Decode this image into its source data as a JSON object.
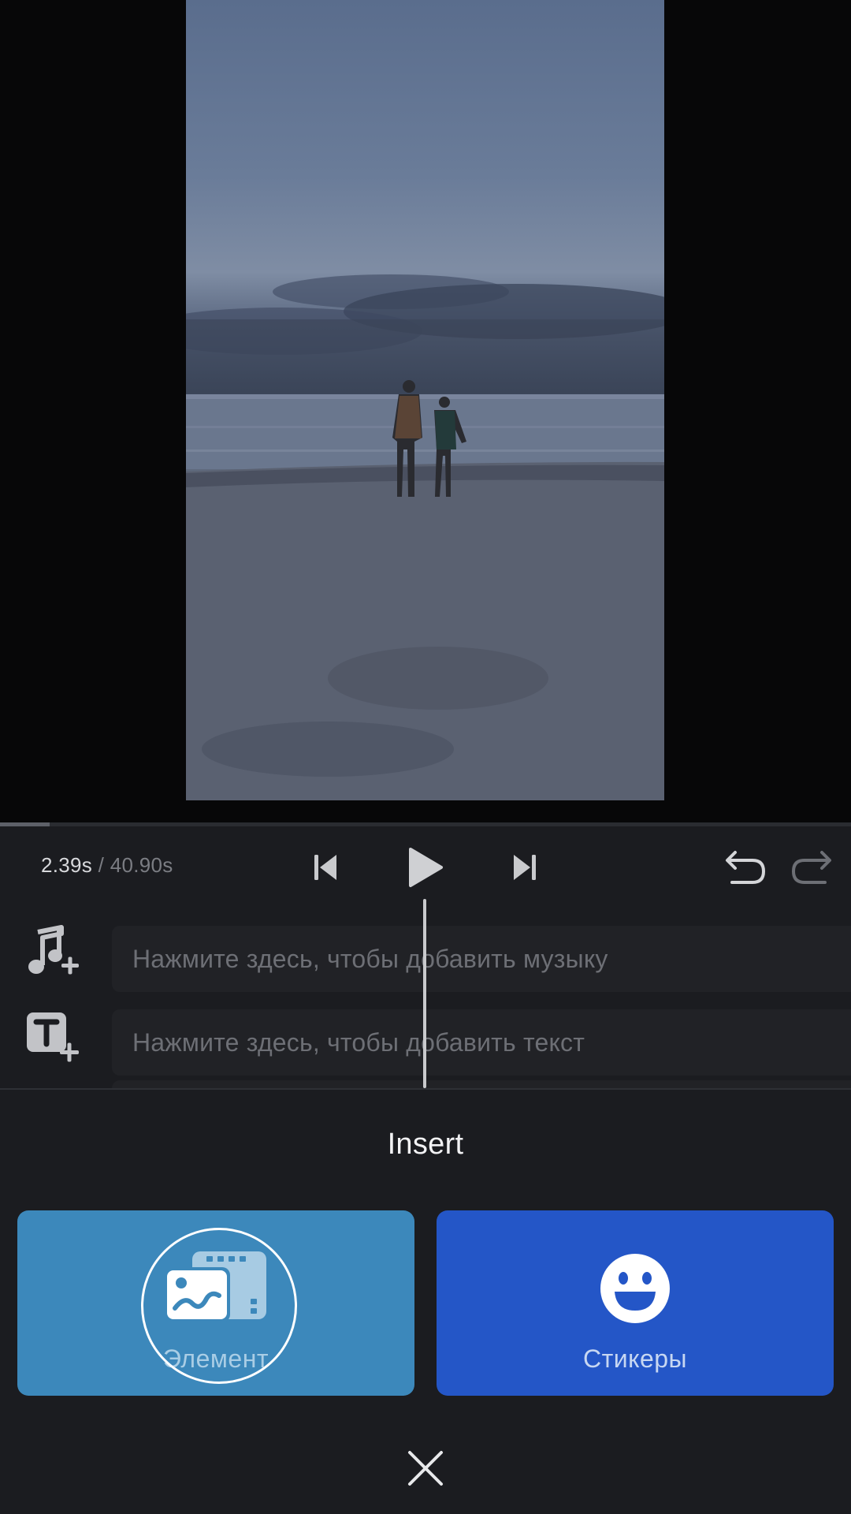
{
  "player": {
    "current_time": "2.39s",
    "separator": " / ",
    "total_time": "40.90s",
    "progress_fraction": 0.0584
  },
  "tracks": {
    "music_placeholder": "Нажмите здесь, чтобы добавить музыку",
    "text_placeholder": "Нажмите здесь, чтобы добавить текст"
  },
  "insert_sheet": {
    "title": "Insert",
    "element_label": "Элемент",
    "stickers_label": "Стикеры"
  },
  "icons": {
    "previous": "skip-previous-icon",
    "play": "play-icon",
    "next": "skip-next-icon",
    "undo": "undo-icon",
    "redo": "redo-icon",
    "add_music": "add-music-icon",
    "add_text": "add-text-icon",
    "element": "element-media-icon",
    "stickers": "smiley-icon",
    "close": "close-icon"
  },
  "colors": {
    "element_card": "#3c88bb",
    "stickers_card": "#2456c7",
    "sheet_background": "#1b1c20"
  }
}
